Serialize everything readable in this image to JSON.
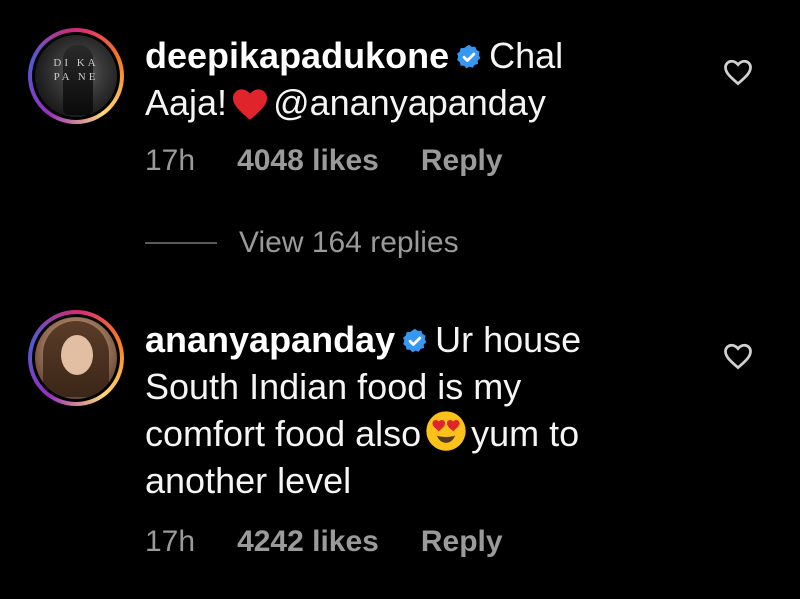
{
  "comments": [
    {
      "username": "deepikapadukone",
      "text_part1": "Chal",
      "text_part2": "Aaja!",
      "text_part3": "@ananyapanday",
      "emoji": "red-heart",
      "time": "17h",
      "likes": "4048 likes",
      "reply_label": "Reply",
      "avatar_text_line1": "DI  KA",
      "avatar_text_line2": "PA   NE",
      "view_replies_label": "View 164 replies"
    },
    {
      "username": "ananyapanday",
      "text_part1": "Ur house",
      "text_part2": "South Indian food is my",
      "text_part3": "comfort food also",
      "text_part4": "yum to",
      "text_part5": "another level",
      "emoji": "heart-eyes-face",
      "time": "17h",
      "likes": "4242 likes",
      "reply_label": "Reply"
    }
  ],
  "colors": {
    "background": "#000000",
    "text": "#f5f5f5",
    "meta": "#9a9a9a",
    "verified": "#3897f0",
    "heart_emoji": "#e0242b",
    "avatar_ring_start": "#d62976",
    "avatar_ring_end": "#fa7e1e"
  },
  "icons": {
    "verified": "verified-badge-icon",
    "like": "heart-outline-icon"
  }
}
